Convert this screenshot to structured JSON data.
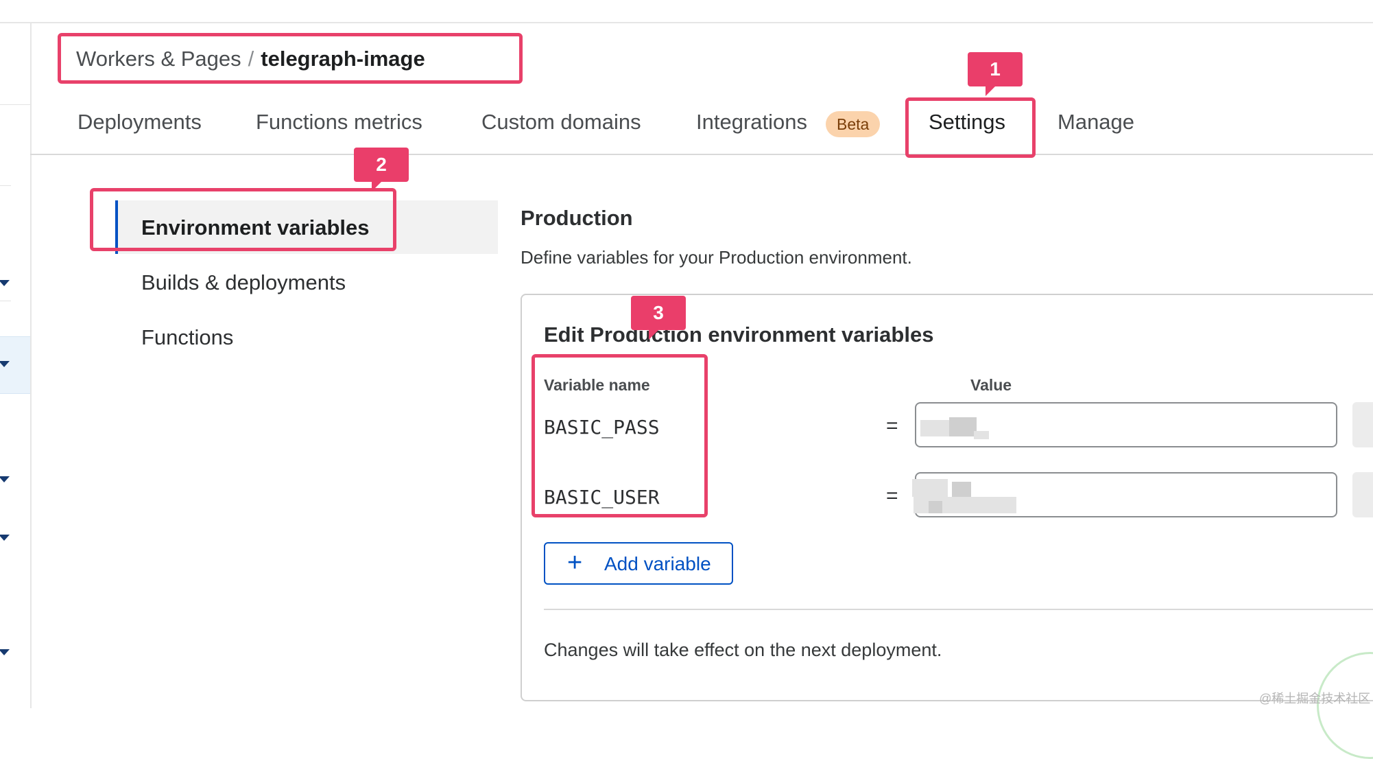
{
  "breadcrumb": {
    "parent": "Workers & Pages",
    "separator": "/",
    "current": "telegraph-image"
  },
  "tabs": [
    {
      "label": "Deployments"
    },
    {
      "label": "Functions metrics"
    },
    {
      "label": "Custom domains"
    },
    {
      "label": "Integrations",
      "badge": "Beta"
    },
    {
      "label": "Settings",
      "active": true
    },
    {
      "label": "Manage"
    }
  ],
  "subnav": [
    {
      "label": "Environment variables",
      "active": true
    },
    {
      "label": "Builds & deployments"
    },
    {
      "label": "Functions"
    }
  ],
  "section": {
    "title": "Production",
    "description": "Define variables for your Production environment."
  },
  "card": {
    "title": "Edit Production environment variables",
    "column_name": "Variable name",
    "column_value": "Value",
    "equals": "=",
    "variables": [
      {
        "name": "BASIC_PASS"
      },
      {
        "name": "BASIC_USER"
      }
    ],
    "add_button": "Add variable",
    "footnote": "Changes will take effect on the next deployment."
  },
  "annotations": {
    "markers": [
      "1",
      "2",
      "3"
    ],
    "color": "#e8416a"
  },
  "watermark": "@稀土掘金技术社区",
  "colors": {
    "accent": "#0051c3",
    "beta_bg": "#fbd3ac",
    "annotation": "#e8416a"
  }
}
